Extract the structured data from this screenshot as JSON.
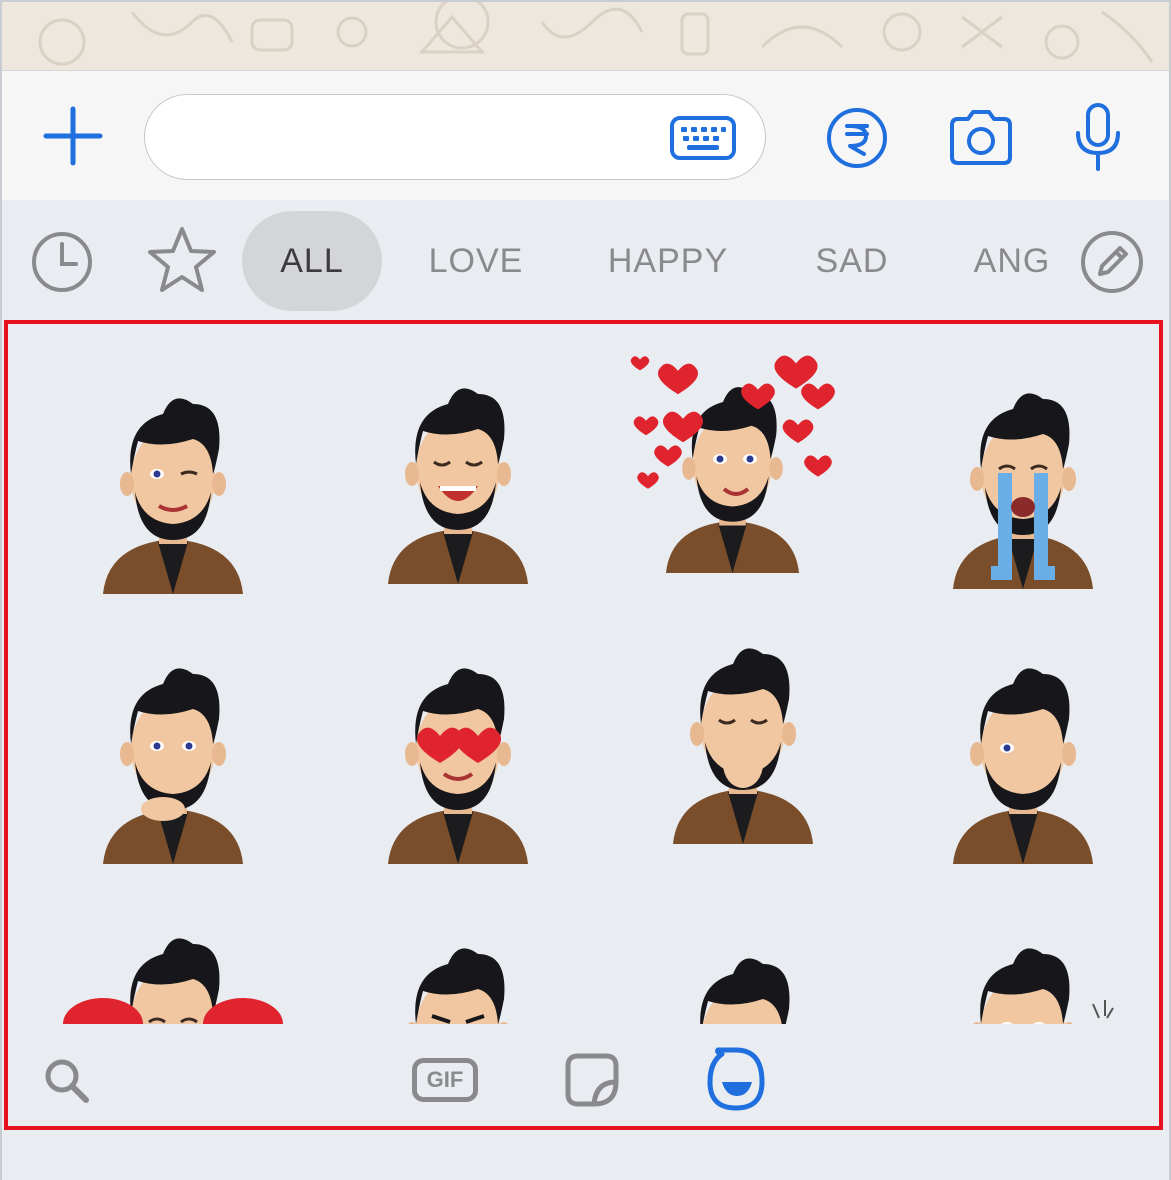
{
  "message_input": {
    "value": "",
    "placeholder": ""
  },
  "categories": [
    "ALL",
    "LOVE",
    "HAPPY",
    "SAD",
    "ANG"
  ],
  "active_category": "ALL",
  "icons": {
    "attach": "plus-icon",
    "keyboard": "keyboard-icon",
    "payment": "rupee-icon",
    "camera": "camera-icon",
    "mic": "microphone-icon",
    "recent": "clock-icon",
    "favorites": "star-icon",
    "edit": "pencil-icon",
    "search": "search-icon",
    "sticker": "sticker-icon",
    "avatar": "avatar-icon"
  },
  "stickers": [
    {
      "id": "wink"
    },
    {
      "id": "laughing"
    },
    {
      "id": "hearts-around"
    },
    {
      "id": "crying"
    },
    {
      "id": "thinking"
    },
    {
      "id": "heart-eyes"
    },
    {
      "id": "giggling"
    },
    {
      "id": "facepalm"
    },
    {
      "id": "sad-tear-hearts"
    },
    {
      "id": "angry"
    },
    {
      "id": "smiling"
    },
    {
      "id": "surprised"
    }
  ],
  "bottom_tabs": {
    "gif_label": "GIF"
  },
  "colors": {
    "accent": "#1f6fde",
    "selection_border": "#e8111f",
    "chip_active": "#d4d5d9",
    "category_text": "#8a8a8e"
  }
}
